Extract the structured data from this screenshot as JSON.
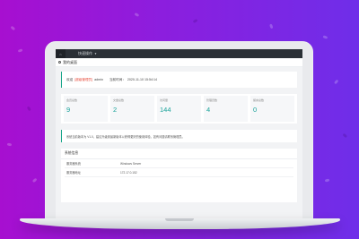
{
  "nav": {
    "home_icon": "home-icon",
    "menu_label": "快速操作"
  },
  "page_title": "我的桌面",
  "welcome": {
    "prefix": "欢迎",
    "role": "[超级管理员]",
    "name": "admin",
    "login_label": "当前时间：",
    "login_time": "2020-11-10 15:54:14"
  },
  "stats": [
    {
      "label": "会员总数",
      "value": "9"
    },
    {
      "label": "文章总数",
      "value": "2"
    },
    {
      "label": "访问量",
      "value": "144"
    },
    {
      "label": "管理员数",
      "value": "4"
    },
    {
      "label": "留言总数",
      "value": "0"
    }
  ],
  "notice": "系统当前版本为 V1.0，建议升级到最新版本以获得更好的使用体验，如有问题请联系管理员。",
  "system_info": {
    "title": "系统信息",
    "rows": [
      {
        "key": "服务器系统",
        "value": "Windows Server"
      },
      {
        "key": "服务器地址",
        "value": "172.17.0.152"
      }
    ]
  },
  "colors": {
    "accent": "#1aa39a",
    "bg_left": "#a70fd0",
    "bg_right": "#6f2ee9",
    "nav": "#2b3036"
  }
}
